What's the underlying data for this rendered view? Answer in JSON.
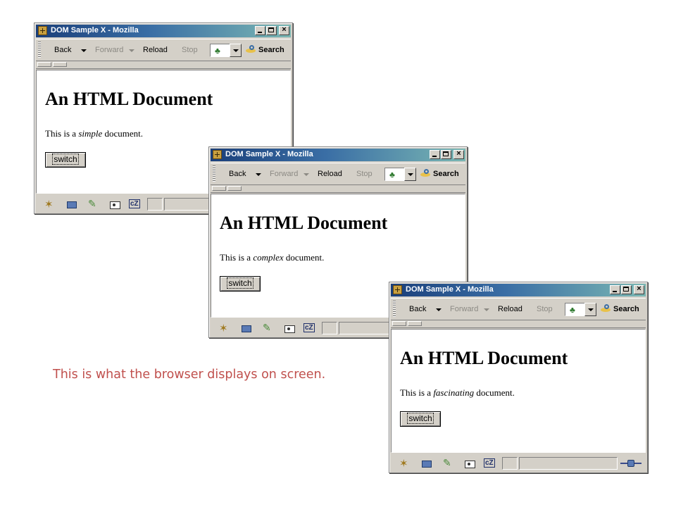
{
  "windows": [
    {
      "title": "DOM Sample X - Mozilla",
      "toolbar": {
        "back": "Back",
        "forward": "Forward",
        "reload": "Reload",
        "stop": "Stop",
        "search": "Search"
      },
      "doc": {
        "heading": "An HTML Document",
        "text_before": "This is a",
        "adjective": "simple",
        "text_after": "document.",
        "button": "switch"
      }
    },
    {
      "title": "DOM Sample X - Mozilla",
      "toolbar": {
        "back": "Back",
        "forward": "Forward",
        "reload": "Reload",
        "stop": "Stop",
        "search": "Search"
      },
      "doc": {
        "heading": "An HTML Document",
        "text_before": "This is a",
        "adjective": "complex",
        "text_after": "document.",
        "button": "switch"
      }
    },
    {
      "title": "DOM Sample X - Mozilla",
      "toolbar": {
        "back": "Back",
        "forward": "Forward",
        "reload": "Reload",
        "stop": "Stop",
        "search": "Search"
      },
      "doc": {
        "heading": "An HTML Document",
        "text_before": "This is a",
        "adjective": "fascinating",
        "text_after": "document.",
        "button": "switch"
      }
    }
  ],
  "caption": "This is what the browser displays on screen.",
  "icons": {
    "app": "mozilla-app-icon",
    "back_dropdown": "chevron-down-icon",
    "url": "bookmark-icon",
    "search": "search-icon",
    "statusbar": [
      "navigator-icon",
      "mail-icon",
      "composer-icon",
      "address-book-icon",
      "chatzilla-icon"
    ],
    "online": "online-status-icon"
  },
  "colors": {
    "caption": "#c0504d",
    "titlebar_start": "#1a3f7a",
    "titlebar_end": "#7ab7b3",
    "chrome": "#d4d0c8"
  }
}
